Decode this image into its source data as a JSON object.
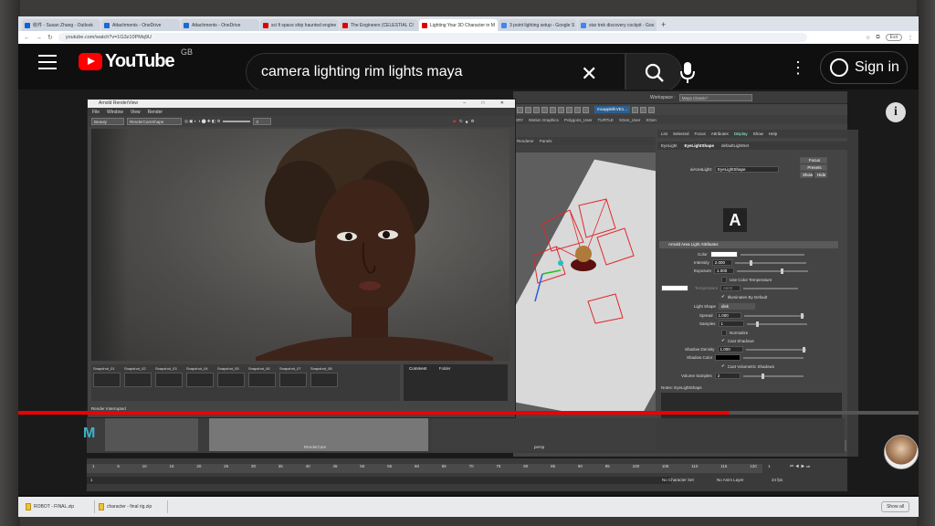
{
  "browser": {
    "tabs": [
      {
        "label": "收件 - Susan Zhang - Outlook",
        "color": "#0a64d8"
      },
      {
        "label": "Attachments - OneDrive",
        "color": "#1b6ad6"
      },
      {
        "label": "Attachments - OneDrive",
        "color": "#1b6ad6"
      },
      {
        "label": "sci fi space ship haunted engine",
        "color": "#e00000"
      },
      {
        "label": "The Engineers (CELESTIAL CI",
        "color": "#e00000"
      },
      {
        "label": "Lighting Your 3D Character in M",
        "color": "#e00000"
      },
      {
        "label": "3 point lighting setup - Google S",
        "color": "#4285f4"
      },
      {
        "label": "star trek discovery cockpit - Goo",
        "color": "#4285f4"
      }
    ],
    "new_tab": "+",
    "url": "youtube.com/watch?v=1G3z10PMq9U",
    "exit_label": "Exit"
  },
  "youtube": {
    "logo_word": "YouTube",
    "region": "GB",
    "search_query": "camera lighting rim lights maya",
    "clear_glyph": "✕",
    "more_glyph": "⋮",
    "signin_label": "Sign in",
    "info_glyph": "i"
  },
  "maya": {
    "workspace_label": "Workspace :",
    "workspace_value": "Maya Classic*",
    "shelf_selector": "mcapplefirVE1...",
    "shelf_tabs": [
      "ERY",
      "Motion Graphics",
      "Polygons_User",
      "TURTLE",
      "XGen_User",
      "XGen"
    ],
    "viewport_menu": [
      "Renderer",
      "Panels"
    ],
    "attr_menu": [
      "List",
      "Selected",
      "Focus",
      "Attributes",
      "Display",
      "Show",
      "Help"
    ],
    "attr_tabs": [
      "EyeLight",
      "EyeLightShape",
      "defaultLightSet"
    ],
    "node_label": "aiAreaLight:",
    "node_value": "EyeLightShape",
    "focus_btn": "Focus",
    "presets_btn": "Presets",
    "show_btn": "Show",
    "hide_btn": "Hide",
    "section_title": "Arnold Area Light Attributes",
    "color_label": "Color",
    "intensity_label": "Intensity",
    "intensity_value": "2.000",
    "exposure_label": "Exposure",
    "exposure_value": "1.000",
    "use_color_temp": "Use Color Temperature",
    "temperature_label": "Temperature",
    "temperature_value": "6500",
    "illuminates_default": "Illuminates By Default",
    "light_shape_label": "Light Shape",
    "light_shape_value": "disk",
    "spread_label": "Spread",
    "spread_value": "1.000",
    "samples_label": "Samples",
    "samples_value": "1",
    "normalize": "Normalize",
    "cast_shadows": "Cast Shadows",
    "shadow_density_label": "Shadow Density",
    "shadow_density_value": "1.000",
    "shadow_color_label": "Shadow Color",
    "cast_volumetric": "Cast Volumetric Shadows",
    "volume_samples_label": "Volume Samples",
    "volume_samples_value": "2",
    "notes_label": "Notes: EyeLightShape",
    "footer_buttons": [
      "Select",
      "Load Attributes",
      "Copy Tab"
    ],
    "side_tabs": [
      "Channel Box / Layer Editor",
      "Modeling Toolkit",
      "Attribute Editor",
      "XGen",
      "Hypershade"
    ],
    "arnold_logo": "A"
  },
  "render_view": {
    "title": "Arnold RenderView",
    "window_controls": "– □ ✕",
    "menu": [
      "File",
      "Window",
      "View",
      "Render"
    ],
    "channel": "Beauty",
    "camera": "RenderCamShape",
    "exposure_value": "0",
    "snapshots": [
      "Snapshot_01",
      "Snapshot_02",
      "Snapshot_03",
      "Snapshot_04",
      "Snapshot_05",
      "Snapshot_06",
      "Snapshot_07",
      "Snapshot_08"
    ],
    "comment_label": "Comment",
    "folder_label": "Folder",
    "status": "Render Interrupted"
  },
  "lower_panes": {
    "cam_label": "RenderCam",
    "persp_label": "persp",
    "maya_logo": "M"
  },
  "timeline": {
    "ticks": [
      "1",
      "5",
      "10",
      "15",
      "20",
      "25",
      "30",
      "35",
      "40",
      "45",
      "50",
      "55",
      "60",
      "65",
      "70",
      "75",
      "80",
      "85",
      "90",
      "95",
      "100",
      "105",
      "110",
      "115",
      "120"
    ],
    "start": "1",
    "current": "1",
    "no_character_set": "No Character Set",
    "no_anim_layer": "No Anim Layer",
    "fps": "24 fps"
  },
  "video_progress": 0.79,
  "downloads": {
    "items": [
      "ROBOT - FINAL.zip",
      "character - final rig.zip"
    ],
    "show_all": "Show all"
  },
  "colors": {
    "youtube_red": "#ff0000",
    "progress_red": "#e00000",
    "maya_bg": "#444444"
  }
}
